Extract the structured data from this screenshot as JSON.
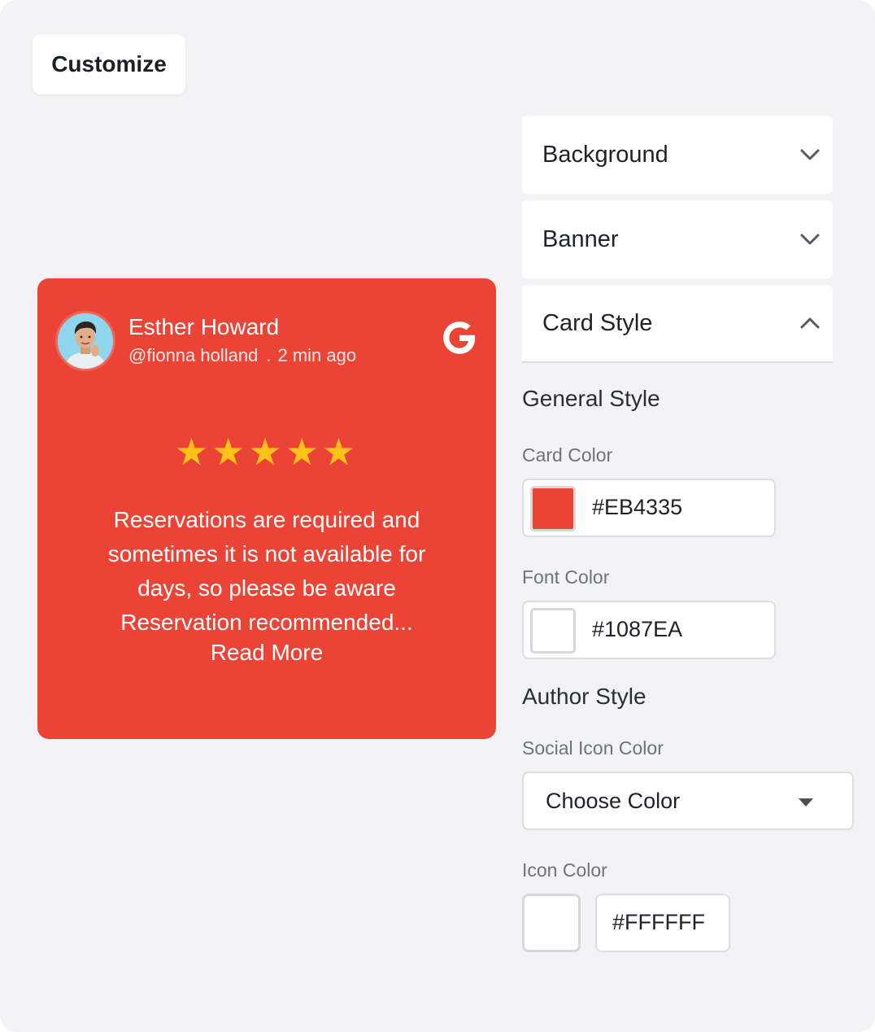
{
  "header": {
    "customize_label": "Customize"
  },
  "review": {
    "author_name": "Esther Howard",
    "handle": "@fionna holland",
    "separator": ".",
    "time_ago": "2 min ago",
    "stars": "★★★★★",
    "rating": 5,
    "text": "Reservations are required and sometimes it is not available for days, so please be aware Reservation recommended...",
    "read_more": "Read More",
    "social_icon": "google-icon",
    "card_color": "#EB4335",
    "star_color": "#FFC21A"
  },
  "panels": [
    {
      "label": "Background",
      "state": "collapsed",
      "icon": "chevron-down-icon"
    },
    {
      "label": "Banner",
      "state": "collapsed",
      "icon": "chevron-down-icon"
    },
    {
      "label": "Card Style",
      "state": "expanded",
      "icon": "chevron-up-icon"
    }
  ],
  "card_style": {
    "general_title": "General Style",
    "card_color_label": "Card Color",
    "card_color_value": "#EB4335",
    "font_color_label": "Font Color",
    "font_color_value": "#1087EA",
    "author_title": "Author Style",
    "social_icon_color_label": "Social Icon Color",
    "social_icon_color_value": "Choose Color",
    "icon_color_label": "Icon Color",
    "icon_color_value": "#FFFFFF"
  }
}
